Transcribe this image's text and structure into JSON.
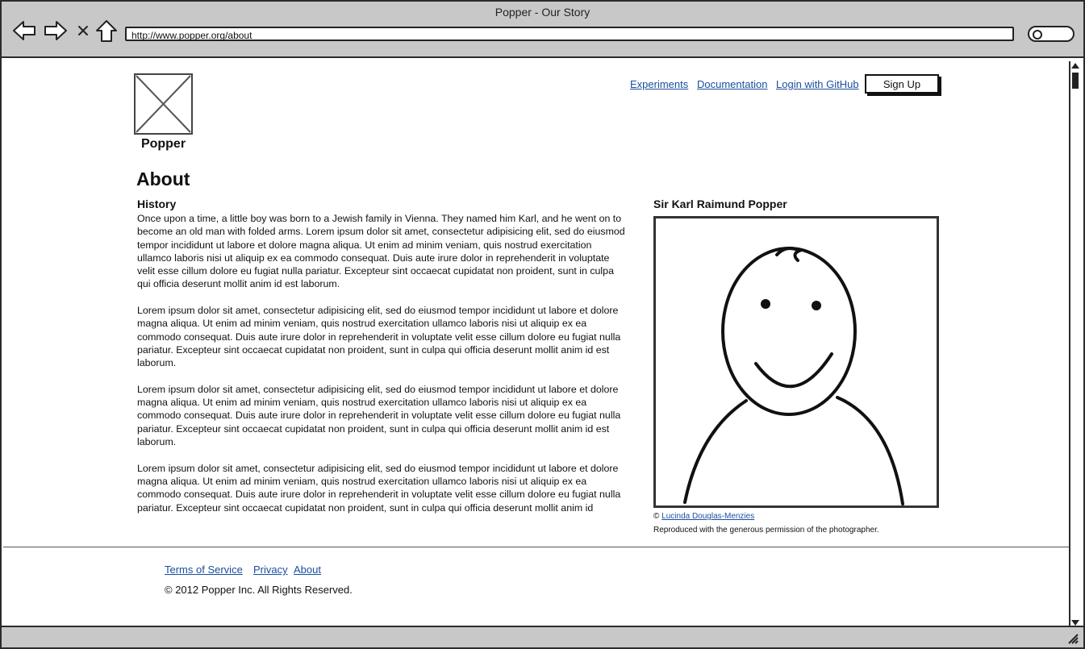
{
  "browser": {
    "window_title": "Popper - Our Story",
    "url": "http://www.popper.org/about"
  },
  "header": {
    "logo_name": "Popper",
    "nav": {
      "experiments": "Experiments",
      "documentation": "Documentation",
      "login": "Login with GitHub"
    },
    "signup_label": "Sign Up"
  },
  "main": {
    "title": "About",
    "section_title": "History",
    "paragraphs": [
      "Once upon a time, a little boy was born to a Jewish family in Vienna. They named him Karl, and he went on to become an old man with folded arms. Lorem ipsum dolor sit amet, consectetur adipisicing elit, sed do eiusmod tempor incididunt ut labore et dolore magna aliqua. Ut enim ad minim veniam, quis nostrud exercitation ullamco laboris nisi ut aliquip ex ea commodo consequat. Duis aute irure dolor in reprehenderit in voluptate velit esse cillum dolore eu fugiat nulla pariatur. Excepteur sint occaecat cupidatat non proident, sunt in culpa qui officia deserunt mollit anim id est laborum.",
      "Lorem ipsum dolor sit amet, consectetur adipisicing elit, sed do eiusmod tempor incididunt ut labore et dolore magna aliqua. Ut enim ad minim veniam, quis nostrud exercitation ullamco laboris nisi ut aliquip ex ea commodo consequat. Duis aute irure dolor in reprehenderit in voluptate velit esse cillum dolore eu fugiat nulla pariatur. Excepteur sint occaecat cupidatat non proident, sunt in culpa qui officia deserunt mollit anim id est laborum.",
      "Lorem ipsum dolor sit amet, consectetur adipisicing elit, sed do eiusmod tempor incididunt ut labore et dolore magna aliqua. Ut enim ad minim veniam, quis nostrud exercitation ullamco laboris nisi ut aliquip ex ea commodo consequat. Duis aute irure dolor in reprehenderit in voluptate velit esse cillum dolore eu fugiat nulla pariatur. Excepteur sint occaecat cupidatat non proident, sunt in culpa qui officia deserunt mollit anim id est laborum.",
      "Lorem ipsum dolor sit amet, consectetur adipisicing elit, sed do eiusmod tempor incididunt ut labore et dolore magna aliqua. Ut enim ad minim veniam, quis nostrud exercitation ullamco laboris nisi ut aliquip ex ea commodo consequat. Duis aute irure dolor in reprehenderit in voluptate velit esse cillum dolore eu fugiat nulla pariatur. Excepteur sint occaecat cupidatat non proident, sunt in culpa qui officia deserunt mollit anim id"
    ]
  },
  "sidebar": {
    "title": "Sir Karl Raimund Popper",
    "credit_symbol": "©",
    "credit_name": "Lucinda Douglas-Menzies",
    "permission": "Reproduced with the generous permission of the photographer."
  },
  "footer": {
    "links": {
      "terms": "Terms of Service",
      "privacy": "Privacy",
      "about": "About"
    },
    "copyright": "© 2012 Popper Inc. All Rights Reserved."
  },
  "colors": {
    "chrome": "#c8c8c8",
    "link": "#1a4e9e",
    "border": "#2b2b2b"
  },
  "icons": [
    "back-arrow-icon",
    "forward-arrow-icon",
    "stop-icon",
    "home-icon",
    "search-icon",
    "resize-grip-icon",
    "placeholder-image-icon",
    "smiley-portrait-sketch"
  ]
}
